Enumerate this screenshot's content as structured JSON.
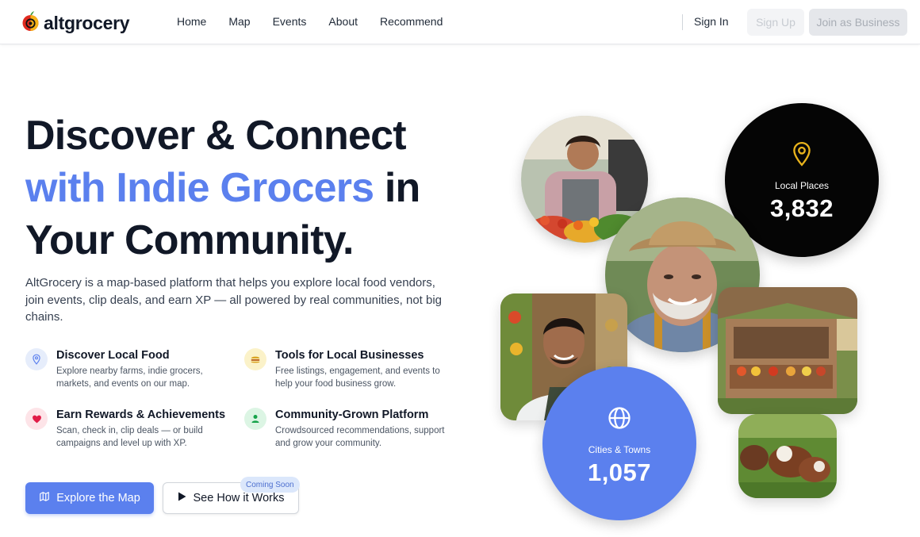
{
  "brand": {
    "name": "altgrocery"
  },
  "nav": {
    "links": [
      "Home",
      "Map",
      "Events",
      "About",
      "Recommend"
    ],
    "sign_in": "Sign In",
    "sign_up": "Sign Up",
    "join_business": "Join as Business"
  },
  "hero": {
    "headline_line1": "Discover & Connect",
    "headline_accent": "with Indie Grocers",
    "headline_in": " in",
    "headline_line3": "Your Community.",
    "description": "AltGrocery is a map-based platform that helps you explore local food vendors, join events, clip deals, and earn XP — all powered by real communities, not big chains."
  },
  "features": [
    {
      "title": "Discover Local Food",
      "desc": "Explore nearby farms, indie grocers, markets, and events on our map.",
      "icon": "location-pin-icon",
      "color": "#5b80ee"
    },
    {
      "title": "Tools for Local Businesses",
      "desc": "Free listings, engagement, and events to help your food business grow.",
      "icon": "burger-icon",
      "color": "#d4a017"
    },
    {
      "title": "Earn Rewards & Achievements",
      "desc": "Scan, check in, clip deals — or build campaigns and level up with XP.",
      "icon": "heart-icon",
      "color": "#e11d48"
    },
    {
      "title": "Community-Grown Platform",
      "desc": "Crowdsourced recommendations, support and grow your community.",
      "icon": "person-icon",
      "color": "#16a34a"
    }
  ],
  "cta": {
    "primary": "Explore the Map",
    "secondary": "See How it Works",
    "badge": "Coming Soon"
  },
  "stats": {
    "places_label": "Local Places",
    "places_value": "3,832",
    "cities_label": "Cities & Towns",
    "cities_value": "1,057"
  },
  "colors": {
    "accent": "#5b80ee",
    "dark": "#050505"
  }
}
